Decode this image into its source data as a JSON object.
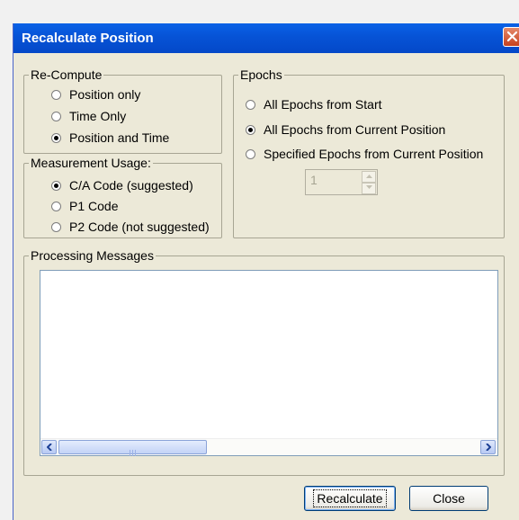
{
  "dialog": {
    "title": "Recalculate Position",
    "recompute": {
      "legend": "Re-Compute",
      "options": [
        {
          "label": "Position only",
          "selected": false
        },
        {
          "label": "Time Only",
          "selected": false
        },
        {
          "label": "Position and Time",
          "selected": true
        }
      ]
    },
    "measurement": {
      "legend": "Measurement Usage:",
      "options": [
        {
          "label": "C/A Code (suggested)",
          "selected": true
        },
        {
          "label": "P1 Code",
          "selected": false
        },
        {
          "label": "P2 Code (not suggested)",
          "selected": false
        }
      ]
    },
    "epochs": {
      "legend": "Epochs",
      "options": [
        {
          "label": "All Epochs from Start",
          "selected": false
        },
        {
          "label": "All Epochs from Current Position",
          "selected": true
        },
        {
          "label": "Specified Epochs from Current Position",
          "selected": false
        }
      ],
      "spinner_value": "1"
    },
    "messages": {
      "legend": "Processing Messages",
      "scroll_thumb_grip": "III"
    },
    "buttons": {
      "recalculate": "Recalculate",
      "close": "Close"
    }
  },
  "colors": {
    "titlebar": "#0653d6",
    "dialog_bg": "#ece9d8",
    "close_button": "#c6401e"
  }
}
